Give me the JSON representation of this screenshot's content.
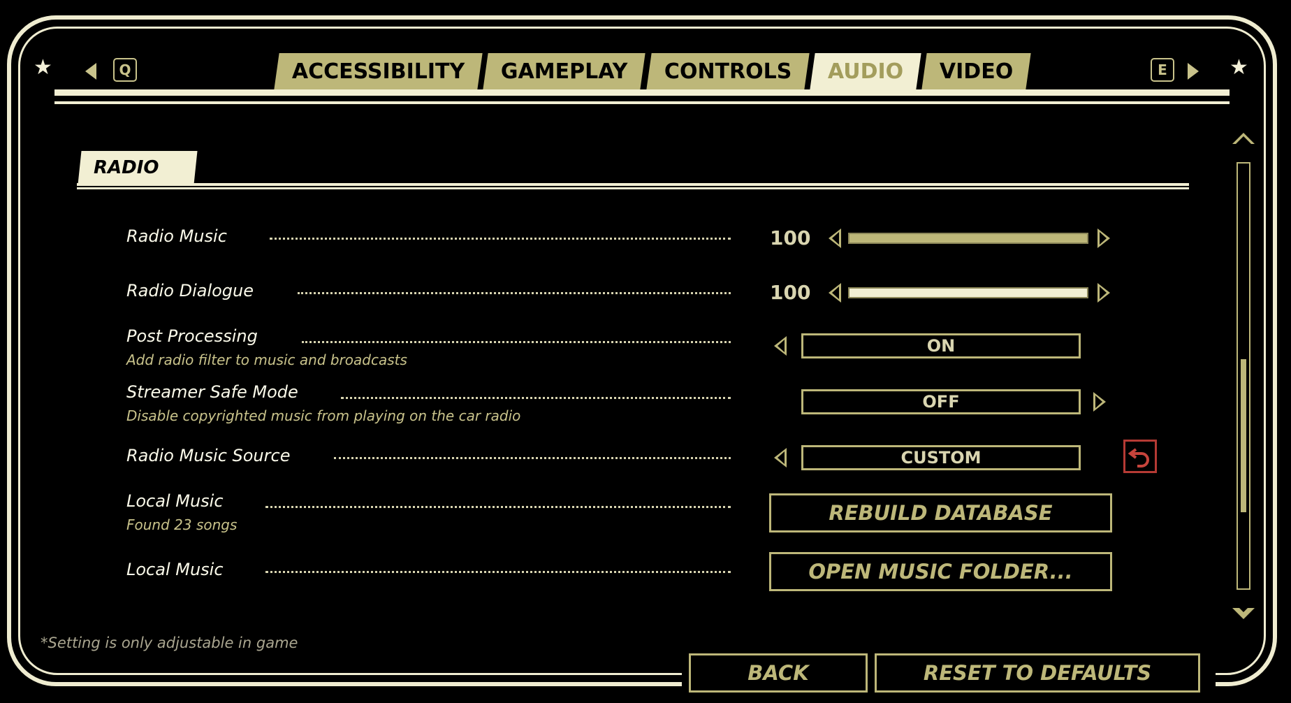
{
  "header": {
    "prev_key": "Q",
    "next_key": "E",
    "tabs": [
      {
        "label": "ACCESSIBILITY",
        "active": false
      },
      {
        "label": "GAMEPLAY",
        "active": false
      },
      {
        "label": "CONTROLS",
        "active": false
      },
      {
        "label": "AUDIO",
        "active": true
      },
      {
        "label": "VIDEO",
        "active": false
      }
    ]
  },
  "section": {
    "title": "RADIO"
  },
  "settings": {
    "radio_music": {
      "label": "Radio Music",
      "value": "100",
      "level": 1.0
    },
    "radio_dialogue": {
      "label": "Radio Dialogue",
      "value": "100",
      "level": 1.0
    },
    "post_processing": {
      "label": "Post Processing",
      "description": "Add radio filter to music and broadcasts",
      "value": "ON"
    },
    "streamer_safe": {
      "label": "Streamer Safe Mode",
      "description": "Disable copyrighted music from playing on the car radio",
      "value": "OFF"
    },
    "music_source": {
      "label": "Radio Music Source",
      "value": "CUSTOM"
    },
    "local_music_rebuild": {
      "label": "Local Music",
      "description": "Found 23 songs",
      "button": "REBUILD DATABASE"
    },
    "local_music_folder": {
      "label": "Local Music",
      "button": "OPEN MUSIC FOLDER..."
    }
  },
  "scrollbar": {
    "position": 0.64,
    "thumb_fraction": 0.36
  },
  "footer": {
    "note": "*Setting is only adjustable in game",
    "back_label": "BACK",
    "reset_label": "RESET TO DEFAULTS"
  },
  "colors": {
    "accent": "#bdb779",
    "light": "#f2efd3",
    "reset_red": "#b53a34",
    "slider_active": "#bdb779",
    "slider_focused": "#f2efd3"
  }
}
